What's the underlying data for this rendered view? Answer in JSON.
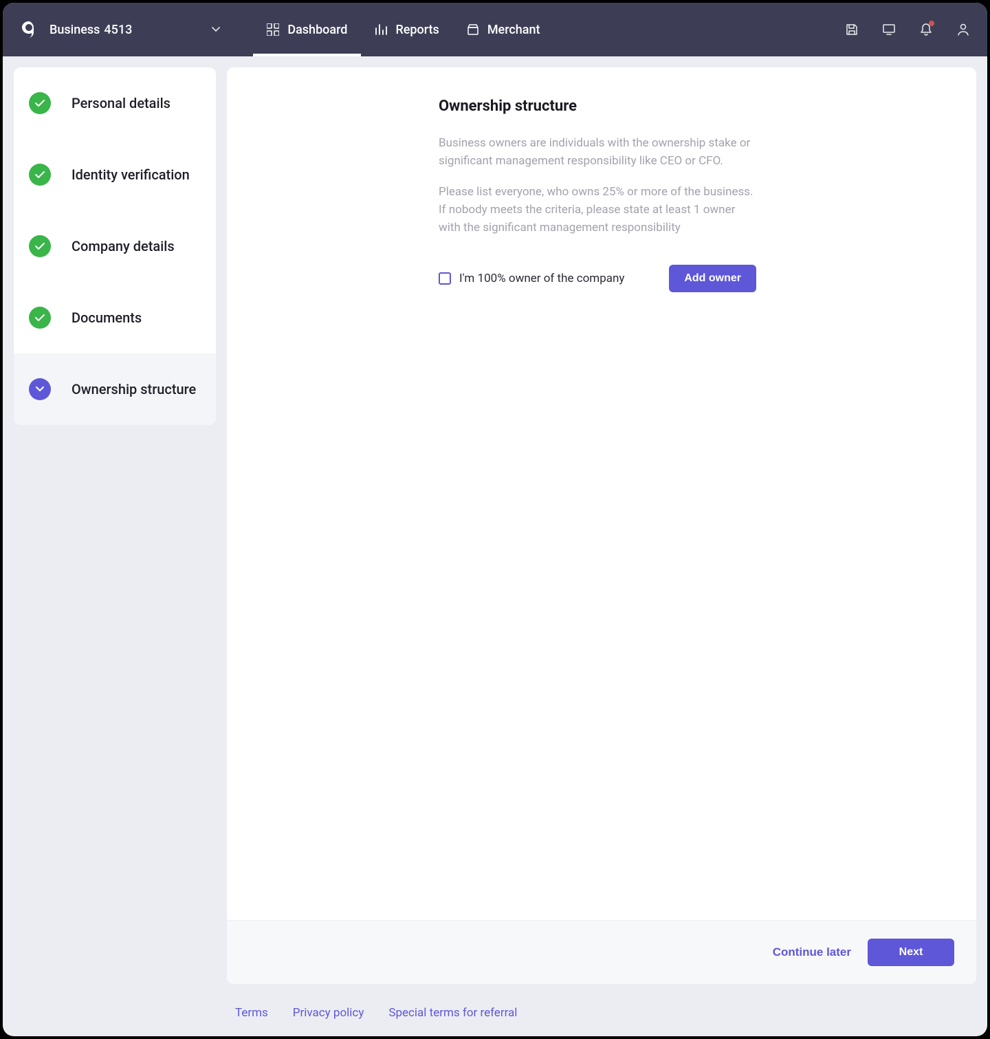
{
  "header": {
    "business_label": "Business",
    "business_id": "4513",
    "nav": {
      "dashboard": "Dashboard",
      "reports": "Reports",
      "merchant": "Merchant"
    }
  },
  "sidebar": {
    "steps": [
      {
        "label": "Personal details",
        "state": "done"
      },
      {
        "label": "Identity verification",
        "state": "done"
      },
      {
        "label": "Company details",
        "state": "done"
      },
      {
        "label": "Documents",
        "state": "done"
      },
      {
        "label": "Ownership structure",
        "state": "current"
      }
    ]
  },
  "main": {
    "title": "Ownership structure",
    "desc1": "Business owners are individuals with the ownership stake or significant management responsibility like CEO or CFO.",
    "desc2": "Please list everyone, who owns 25% or more of the business. If nobody meets the criteria, please state at least 1 owner with the significant management responsibility",
    "checkbox_label": "I'm 100% owner of the company",
    "add_owner_btn": "Add owner",
    "continue_later_btn": "Continue later",
    "next_btn": "Next"
  },
  "footer": {
    "terms": "Terms",
    "privacy": "Privacy policy",
    "referral": "Special terms for referral"
  }
}
